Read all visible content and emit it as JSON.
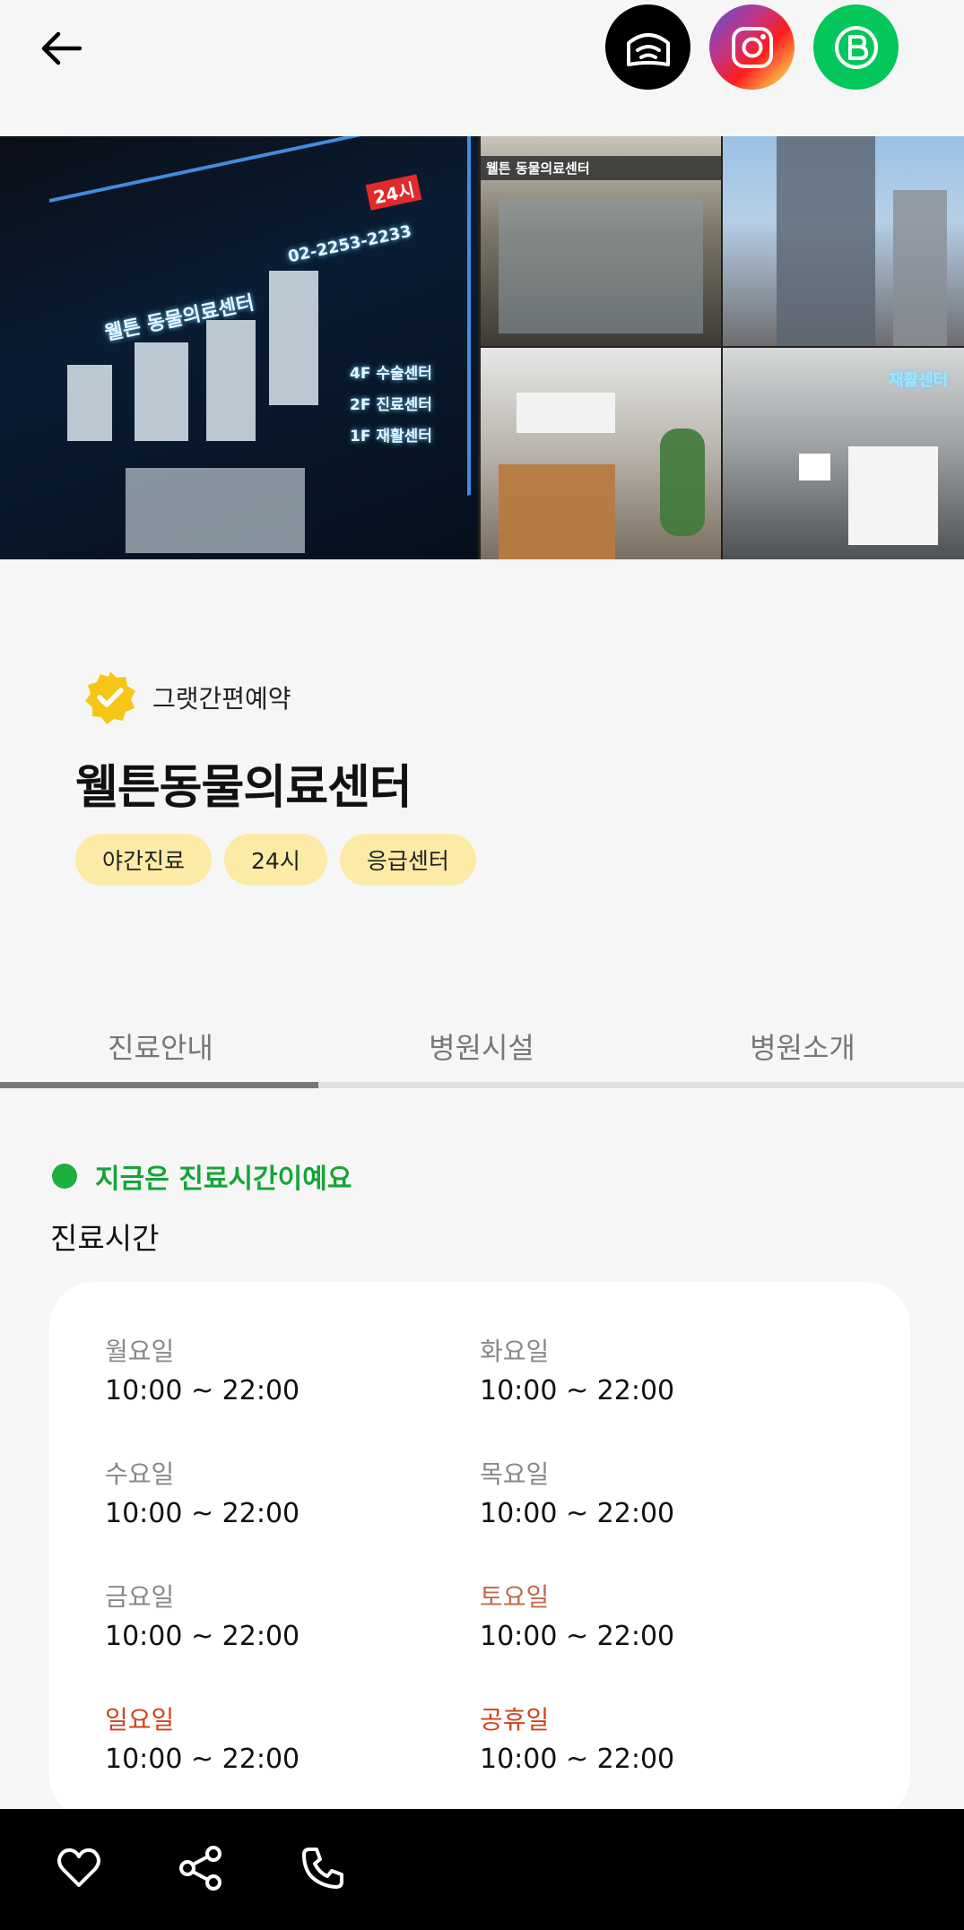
{
  "header": {
    "back_icon": "arrow-left-icon",
    "social_links": [
      {
        "name": "home-icon",
        "color": "#000000"
      },
      {
        "name": "instagram-icon",
        "color": "#c13584"
      },
      {
        "name": "naver-blog-icon",
        "color": "#03c75a"
      }
    ]
  },
  "gallery": {
    "main_photo": {
      "sign_phone": "02-2253-2233",
      "sign_24": "24시",
      "sign_name": "웰튼 동물의료센터",
      "floors": [
        "4F 수술센터",
        "2F 진료센터",
        "1F 재활센터"
      ]
    },
    "photo_1_sign": "웰튼 동물의료센터",
    "photo_4_sign": "재활센터"
  },
  "badge": {
    "icon": "verified-badge-icon",
    "label": "그랫간편예약",
    "color": "#f5c518"
  },
  "hospital": {
    "name": "웰튼동물의료센터",
    "tags": [
      "야간진료",
      "24시",
      "응급센터"
    ]
  },
  "tabs": [
    {
      "label": "진료안내",
      "active": true
    },
    {
      "label": "병원시설",
      "active": false
    },
    {
      "label": "병원소개",
      "active": false
    }
  ],
  "status": {
    "text": "지금은 진료시간이예요",
    "color": "#15a537"
  },
  "hours": {
    "title": "진료시간",
    "days": [
      {
        "day": "월요일",
        "time": "10:00 ~ 22:00"
      },
      {
        "day": "화요일",
        "time": "10:00 ~ 22:00"
      },
      {
        "day": "수요일",
        "time": "10:00 ~ 22:00"
      },
      {
        "day": "목요일",
        "time": "10:00 ~ 22:00"
      },
      {
        "day": "금요일",
        "time": "10:00 ~ 22:00"
      },
      {
        "day": "토요일",
        "time": "10:00 ~ 22:00"
      },
      {
        "day": "일요일",
        "time": "10:00 ~ 22:00"
      },
      {
        "day": "공휴일",
        "time": "10:00 ~ 22:00"
      }
    ]
  },
  "bottom_bar": {
    "actions": [
      {
        "name": "heart-icon"
      },
      {
        "name": "share-icon"
      },
      {
        "name": "phone-icon"
      }
    ]
  }
}
